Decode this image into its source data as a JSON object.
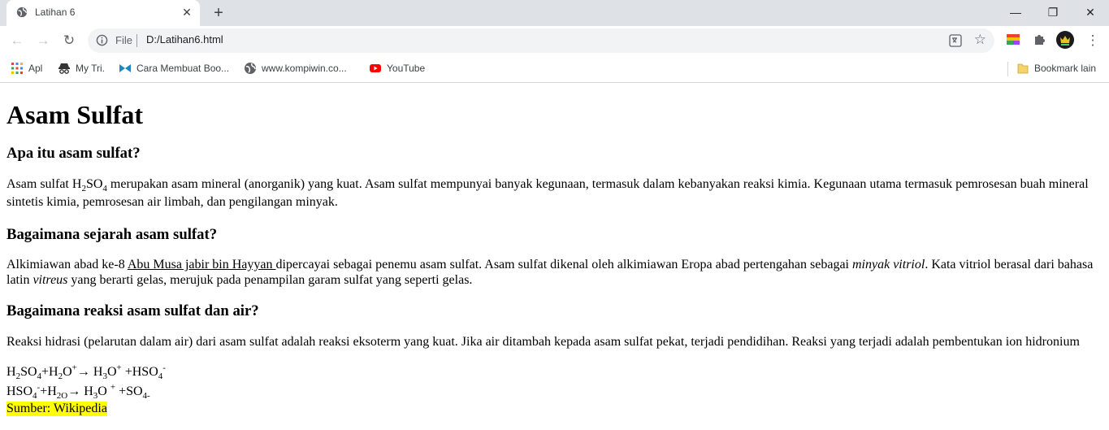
{
  "browser": {
    "tab_title": "Latihan 6",
    "url_scheme_label": "File",
    "url": "D:/Latihan6.html",
    "new_tab_label": "+",
    "tab_close_label": "✕",
    "minimize_label": "—",
    "restore_label": "❐",
    "close_label": "✕",
    "back_label": "←",
    "forward_label": "→",
    "reload_label": "↻",
    "star_label": "☆",
    "menu_label": "⋮",
    "bookmarks": [
      {
        "label": "Apl",
        "icon": "apps-grid-icon"
      },
      {
        "label": "My Tri.",
        "icon": "spy-icon"
      },
      {
        "label": "Cara Membuat Boo...",
        "icon": "blue-logo-icon"
      },
      {
        "label": "www.kompiwin.co...",
        "icon": "globe-icon"
      },
      {
        "label": "YouTube",
        "icon": "youtube-icon"
      }
    ],
    "other_bookmarks": "Bookmark lain"
  },
  "page": {
    "title": "Asam Sulfat",
    "sections": [
      {
        "heading": "Apa itu asam sulfat?",
        "text_a": "Asam sulfat H",
        "sub1": "2",
        "text_b": "SO",
        "sub2": "4",
        "text_c": " merupakan asam mineral (anorganik) yang kuat. Asam sulfat mempunyai banyak kegunaan, termasuk dalam kebanyakan reaksi kimia. Kegunaan utama termasuk pemrosesan buah mineral sintetis kimia, pemrosesan air limbah, dan pengilangan minyak."
      },
      {
        "heading": "Bagaimana sejarah asam sulfat?",
        "text_a": "Alkimiawan abad ke-8 ",
        "link": "Abu Musa jabir bin Hayyan ",
        "text_b": "dipercayai sebagai penemu asam sulfat. Asam sulfat dikenal oleh alkimiawan Eropa abad pertengahan sebagai ",
        "italic1": "minyak vitriol",
        "text_c": ". Kata vitriol berasal dari bahasa latin ",
        "italic2": "vitreus",
        "text_d": " yang berarti gelas, merujuk pada penampilan garam sulfat yang seperti gelas."
      },
      {
        "heading": "Bagaimana reaksi asam sulfat dan air?",
        "text": "Reaksi hidrasi (pelarutan dalam air) dari asam sulfat adalah reaksi eksoterm yang kuat. Jika air ditambah kepada asam sulfat pekat, terjadi pendidihan. Reaksi yang terjadi adalah pembentukan ion hidronium"
      }
    ],
    "eq1": {
      "a": "H",
      "s1": "2",
      "b": "SO",
      "s2": "4",
      "c": "+H",
      "s3": "2",
      "d": "O",
      "p1": "+",
      "e": "→ H",
      "s4": "3",
      "f": "O",
      "p2": "+",
      "g": " +HSO",
      "s5": "4",
      "p3": "-"
    },
    "eq2": {
      "a": "HSO",
      "s1": "4",
      "p1": "-",
      "b": "+H",
      "s2": "2O",
      "c": "→ H",
      "s3": "3",
      "d": "O ",
      "p2": "+",
      "e": " +SO",
      "s4": "4-"
    },
    "source": "Sumber: Wikipedia"
  }
}
